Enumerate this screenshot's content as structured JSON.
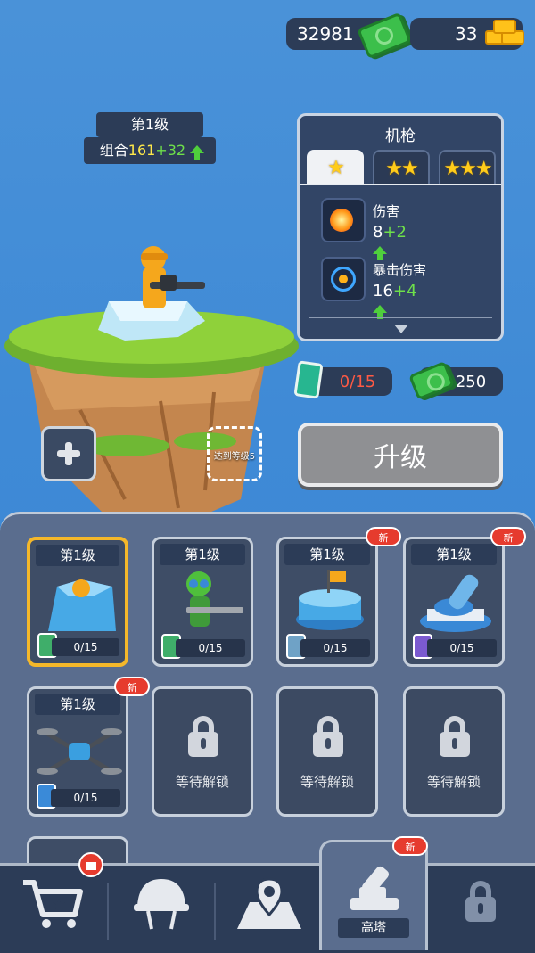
{
  "currency": {
    "cash": "32981",
    "gold": "33"
  },
  "tower": {
    "level_label": "第1级",
    "combo_label": "组合",
    "combo_value": "161",
    "combo_bonus": "+32",
    "slot_hint": "达到等级5"
  },
  "weapon_panel": {
    "title": "机枪",
    "tabs": [
      "1 star",
      "2 stars",
      "3 stars"
    ],
    "stats": [
      {
        "label": "伤害",
        "value": "8",
        "bonus": "+2",
        "icon": "explosion-icon"
      },
      {
        "label": "暴击伤害",
        "value": "16",
        "bonus": "+4",
        "icon": "crosshair-icon"
      }
    ]
  },
  "upgrade": {
    "cards_progress": "0/15",
    "cost": "250",
    "button_label": "升级"
  },
  "units": [
    {
      "level": "第1级",
      "progress": "0/15",
      "new": false,
      "selected": true,
      "card_color": "#3fae6a"
    },
    {
      "level": "第1级",
      "progress": "0/15",
      "new": false,
      "selected": false,
      "card_color": "#3fae6a"
    },
    {
      "level": "第1级",
      "progress": "0/15",
      "new": true,
      "selected": false,
      "card_color": "#6fa2c6"
    },
    {
      "level": "第1级",
      "progress": "0/15",
      "new": true,
      "selected": false,
      "card_color": "#7b5ad0"
    },
    {
      "level": "第1级",
      "progress": "0/15",
      "new": true,
      "selected": false,
      "card_color": "#3a8ad8"
    }
  ],
  "locked_label": "等待解锁",
  "new_label": "新",
  "bottom_nav": {
    "items": [
      {
        "name": "shop",
        "icon": "cart-icon"
      },
      {
        "name": "heroes",
        "icon": "helmet-icon"
      },
      {
        "name": "map",
        "icon": "map-pin-icon"
      },
      {
        "name": "tower",
        "icon": "cannon-icon",
        "label": "高塔"
      },
      {
        "name": "locked",
        "icon": "lock-icon"
      }
    ]
  },
  "colors": {
    "accent_green": "#6ee04a",
    "combo_yellow": "#ffe94a",
    "selected_border": "#f5b82a",
    "badge_red": "#e63b2e"
  }
}
